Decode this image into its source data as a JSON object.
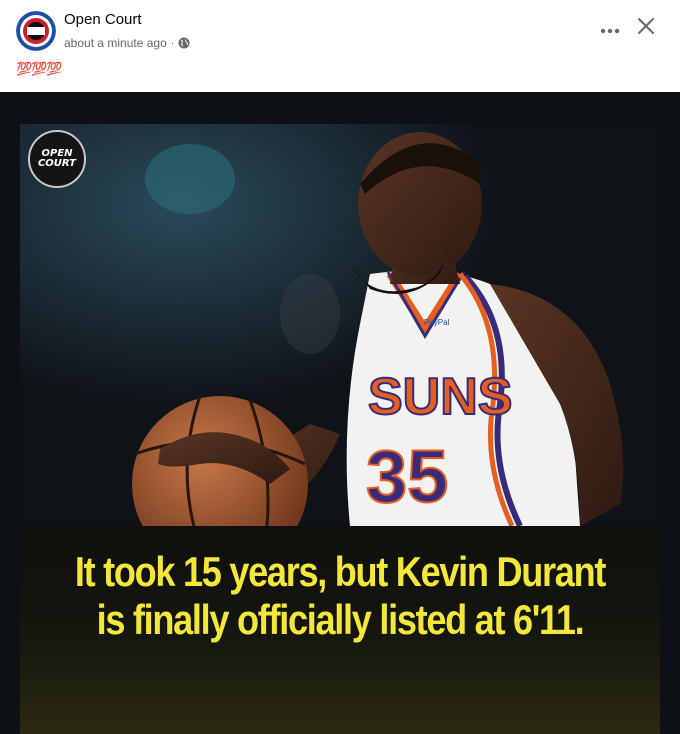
{
  "post": {
    "page_name": "Open Court",
    "timestamp": "about a minute ago",
    "separator": "·",
    "privacy_icon": "globe-icon",
    "caption": "💯💯💯"
  },
  "header_actions": {
    "more_icon": "more-horizontal-icon",
    "close_icon": "close-icon"
  },
  "image": {
    "logo_line1": "OPEN",
    "logo_line2": "COURT",
    "jersey_team": "SUNS",
    "jersey_number": "35",
    "jersey_sponsor": "PayPal",
    "headline_line1": "It took 15 years, but Kevin Durant",
    "headline_line2": "is finally officially listed at 6'11."
  },
  "colors": {
    "headline": "#f3e83a",
    "background": "#0d1115",
    "jersey_orange": "#e56020",
    "jersey_purple": "#3a2a7a"
  }
}
